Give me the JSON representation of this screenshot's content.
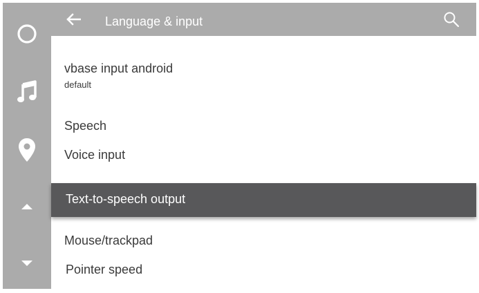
{
  "app_bar": {
    "title": "Language & input",
    "back_icon": "arrow-left-icon",
    "search_icon": "search-icon"
  },
  "rail": {
    "items": [
      {
        "name": "home",
        "icon": "circle-icon"
      },
      {
        "name": "music",
        "icon": "music-note-icon"
      },
      {
        "name": "navigation",
        "icon": "location-pin-icon"
      },
      {
        "name": "scroll-up",
        "icon": "chevron-up-icon"
      },
      {
        "name": "scroll-down",
        "icon": "chevron-down-icon"
      }
    ]
  },
  "list": {
    "items": [
      {
        "title": "vbase input android",
        "subtitle": "default"
      },
      {
        "title": "Speech"
      },
      {
        "title": "Voice input"
      },
      {
        "title": "Text-to-speech output",
        "selected": true
      },
      {
        "title": "Mouse/trackpad"
      },
      {
        "title": "Pointer speed"
      }
    ]
  },
  "colors": {
    "bar_gray": "#ababab",
    "selected_row": "#58585a",
    "text": "#3a3a3a",
    "icon_white": "#ffffff"
  }
}
